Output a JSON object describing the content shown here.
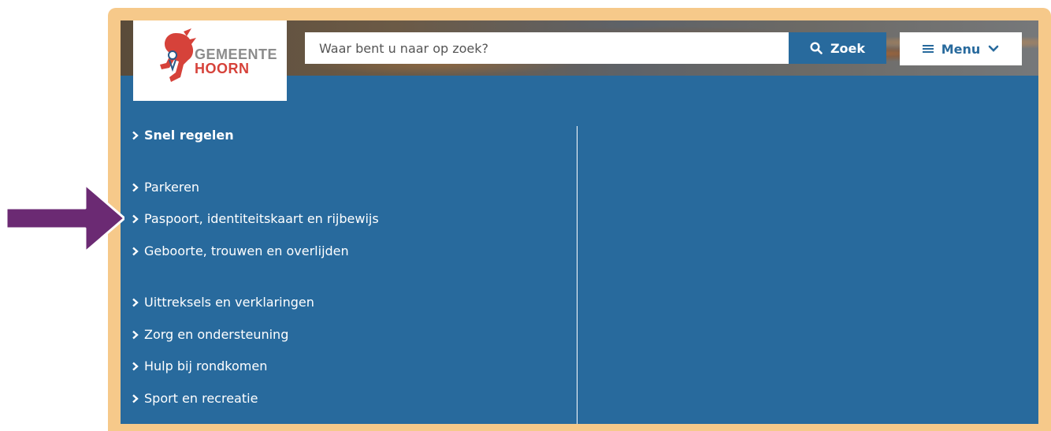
{
  "header": {
    "logo": {
      "line1": "GEMEENTE",
      "line2": "HOORN"
    },
    "search": {
      "placeholder": "Waar bent u naar op zoek?",
      "button_label": "Zoek"
    },
    "menu": {
      "label": "Menu"
    }
  },
  "menu_panel": {
    "items": [
      {
        "label": "Snel regelen",
        "bold": true
      },
      {
        "label": "Parkeren"
      },
      {
        "label": "Paspoort, identiteitskaart en rijbewijs"
      },
      {
        "label": "Geboorte, trouwen en overlijden"
      },
      {
        "label": "Uittreksels en verklaringen"
      },
      {
        "label": "Zorg en ondersteuning"
      },
      {
        "label": "Hulp bij rondkomen"
      },
      {
        "label": "Sport en recreatie"
      }
    ]
  },
  "colors": {
    "primary_blue": "#286a9d",
    "frame_peach": "#f6c98a",
    "logo_red": "#d6423a",
    "logo_grey": "#8c8c8c",
    "annotation_arrow": "#6b2a73"
  },
  "icons": {
    "search": "search-icon",
    "menu": "hamburger-icon",
    "menu_caret": "chevron-down-icon",
    "item_bullet": "chevron-right-icon",
    "annotation": "arrow-right-icon"
  }
}
